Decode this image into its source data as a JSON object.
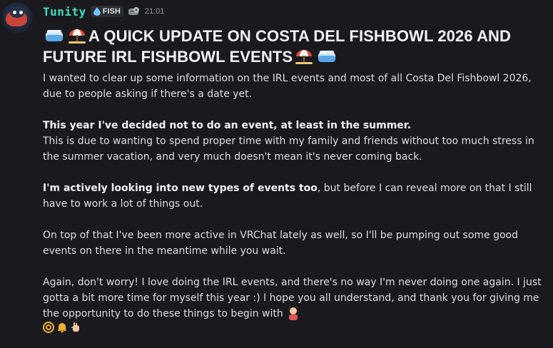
{
  "message": {
    "author": "Tunity",
    "tag": {
      "label": "FISH",
      "icon": "droplet-icon"
    },
    "badge_icon": "gear-badge-icon",
    "timestamp": "21:01",
    "heading": "A QUICK UPDATE ON COSTA DEL FISHBOWL 2026 AND FUTURE IRL FISHBOWL EVENTS",
    "heading_emojis": [
      "fishbowl-emoji",
      "beach-umbrella-emoji"
    ],
    "paragraphs": {
      "p1": "I wanted to clear up some information on the IRL events and most of all Costa Del Fishbowl 2026, due to people asking if there's a date yet.",
      "p2_bold": "This year I've decided not to do an event, at least in the summer.",
      "p2_rest": "This is due to wanting to spend proper time with my family and friends without too much stress in the summer vacation, and very much doesn't mean it's never coming back.",
      "p3_bold": "I'm actively looking into new types of events too",
      "p3_rest": ", but before I can reveal more on that I still have to work a lot of things out.",
      "p4": "On top of that I've been more active in VRChat lately as well, so I'll be pumping out some good events on there in the meantime while you wait.",
      "p5": "Again, don't worry! I love doing the IRL events, and there's no way I'm never doing one again. I just gotta a bit more time for myself this year :) I hope you all understand, and thank you for giving me the opportunity to do these things to begin with"
    },
    "trailing_emoji": "person-emoji",
    "reactions": [
      "at-icon",
      "bell-icon",
      "hand-icon"
    ]
  },
  "colors": {
    "background": "#1a1a1e",
    "username": "#3ee0c2",
    "text": "#dbdee1",
    "heading": "#f2f3f5",
    "timestamp": "#949ba4"
  }
}
